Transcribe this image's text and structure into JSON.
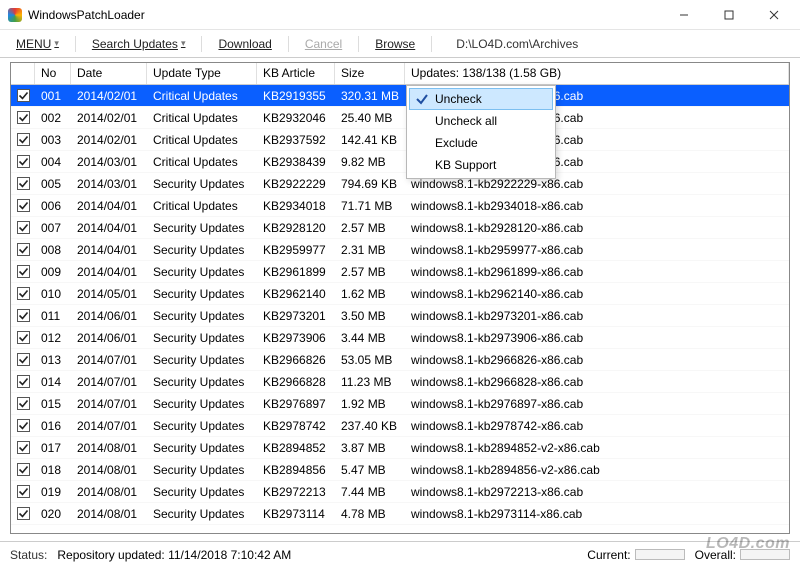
{
  "window": {
    "title": "WindowsPatchLoader"
  },
  "toolbar": {
    "menu": "MENU",
    "search": "Search Updates",
    "download": "Download",
    "cancel": "Cancel",
    "browse": "Browse",
    "path": "D:\\LO4D.com\\Archives"
  },
  "columns": {
    "no": "No",
    "date": "Date",
    "type": "Update Type",
    "kb": "KB Article",
    "size": "Size",
    "updates": "Updates: 138/138   (1.58 GB)"
  },
  "rows": [
    {
      "no": "001",
      "date": "2014/02/01",
      "type": "Critical Updates",
      "kb": "KB2919355",
      "size": "320.31 MB",
      "file": "windows8.1-kb2919355-x86.cab"
    },
    {
      "no": "002",
      "date": "2014/02/01",
      "type": "Critical Updates",
      "kb": "KB2932046",
      "size": "25.40 MB",
      "file": "windows8.1-kb2932046-x86.cab"
    },
    {
      "no": "003",
      "date": "2014/02/01",
      "type": "Critical Updates",
      "kb": "KB2937592",
      "size": "142.41 KB",
      "file": "windows8.1-kb2937592-x86.cab"
    },
    {
      "no": "004",
      "date": "2014/03/01",
      "type": "Critical Updates",
      "kb": "KB2938439",
      "size": "9.82 MB",
      "file": "windows8.1-kb2938439-x86.cab"
    },
    {
      "no": "005",
      "date": "2014/03/01",
      "type": "Security Updates",
      "kb": "KB2922229",
      "size": "794.69 KB",
      "file": "windows8.1-kb2922229-x86.cab"
    },
    {
      "no": "006",
      "date": "2014/04/01",
      "type": "Critical Updates",
      "kb": "KB2934018",
      "size": "71.71 MB",
      "file": "windows8.1-kb2934018-x86.cab"
    },
    {
      "no": "007",
      "date": "2014/04/01",
      "type": "Security Updates",
      "kb": "KB2928120",
      "size": "2.57 MB",
      "file": "windows8.1-kb2928120-x86.cab"
    },
    {
      "no": "008",
      "date": "2014/04/01",
      "type": "Security Updates",
      "kb": "KB2959977",
      "size": "2.31 MB",
      "file": "windows8.1-kb2959977-x86.cab"
    },
    {
      "no": "009",
      "date": "2014/04/01",
      "type": "Security Updates",
      "kb": "KB2961899",
      "size": "2.57 MB",
      "file": "windows8.1-kb2961899-x86.cab"
    },
    {
      "no": "010",
      "date": "2014/05/01",
      "type": "Security Updates",
      "kb": "KB2962140",
      "size": "1.62 MB",
      "file": "windows8.1-kb2962140-x86.cab"
    },
    {
      "no": "011",
      "date": "2014/06/01",
      "type": "Security Updates",
      "kb": "KB2973201",
      "size": "3.50 MB",
      "file": "windows8.1-kb2973201-x86.cab"
    },
    {
      "no": "012",
      "date": "2014/06/01",
      "type": "Security Updates",
      "kb": "KB2973906",
      "size": "3.44 MB",
      "file": "windows8.1-kb2973906-x86.cab"
    },
    {
      "no": "013",
      "date": "2014/07/01",
      "type": "Security Updates",
      "kb": "KB2966826",
      "size": "53.05 MB",
      "file": "windows8.1-kb2966826-x86.cab"
    },
    {
      "no": "014",
      "date": "2014/07/01",
      "type": "Security Updates",
      "kb": "KB2966828",
      "size": "11.23 MB",
      "file": "windows8.1-kb2966828-x86.cab"
    },
    {
      "no": "015",
      "date": "2014/07/01",
      "type": "Security Updates",
      "kb": "KB2976897",
      "size": "1.92 MB",
      "file": "windows8.1-kb2976897-x86.cab"
    },
    {
      "no": "016",
      "date": "2014/07/01",
      "type": "Security Updates",
      "kb": "KB2978742",
      "size": "237.40 KB",
      "file": "windows8.1-kb2978742-x86.cab"
    },
    {
      "no": "017",
      "date": "2014/08/01",
      "type": "Security Updates",
      "kb": "KB2894852",
      "size": "3.87 MB",
      "file": "windows8.1-kb2894852-v2-x86.cab"
    },
    {
      "no": "018",
      "date": "2014/08/01",
      "type": "Security Updates",
      "kb": "KB2894856",
      "size": "5.47 MB",
      "file": "windows8.1-kb2894856-v2-x86.cab"
    },
    {
      "no": "019",
      "date": "2014/08/01",
      "type": "Security Updates",
      "kb": "KB2972213",
      "size": "7.44 MB",
      "file": "windows8.1-kb2972213-x86.cab"
    },
    {
      "no": "020",
      "date": "2014/08/01",
      "type": "Security Updates",
      "kb": "KB2973114",
      "size": "4.78 MB",
      "file": "windows8.1-kb2973114-x86.cab"
    }
  ],
  "contextMenu": {
    "uncheck": "Uncheck",
    "uncheckAll": "Uncheck all",
    "exclude": "Exclude",
    "kbSupport": "KB Support"
  },
  "status": {
    "label": "Status:",
    "text": "Repository updated: 11/14/2018 7:10:42 AM",
    "current": "Current:",
    "overall": "Overall:"
  },
  "watermark": "LO4D.com"
}
